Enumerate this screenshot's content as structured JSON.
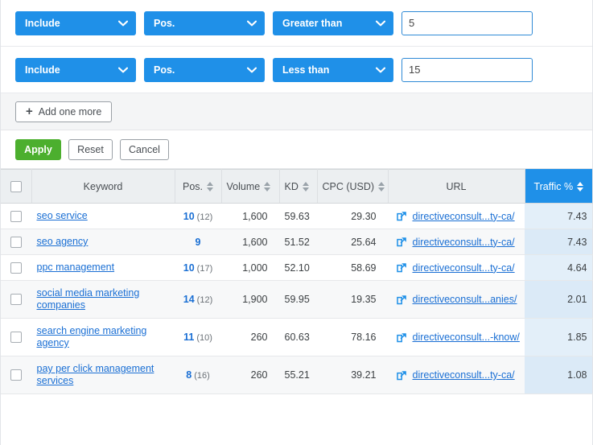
{
  "filters": {
    "rows": [
      {
        "mode": "Include",
        "metric": "Pos.",
        "comparator": "Greater than",
        "value": "5",
        "placeholder": ""
      },
      {
        "mode": "Include",
        "metric": "Pos.",
        "comparator": "Less than",
        "value": "15",
        "placeholder": ""
      }
    ],
    "add_more_label": "Add one more",
    "add_more_plus": "+",
    "apply_label": "Apply",
    "reset_label": "Reset",
    "cancel_label": "Cancel",
    "colors": {
      "dropdown_blue": "#1f90e8",
      "apply_green": "#4caf2e",
      "link_blue": "#1a6fd4",
      "traffic_header_blue": "#1f90e8",
      "traffic_cell_blue": "#e3eff9"
    }
  },
  "table": {
    "columns": [
      {
        "key": "check",
        "label": "",
        "sortable": false
      },
      {
        "key": "keyword",
        "label": "Keyword",
        "sortable": false
      },
      {
        "key": "pos",
        "label": "Pos.",
        "sortable": true
      },
      {
        "key": "volume",
        "label": "Volume",
        "sortable": true
      },
      {
        "key": "kd",
        "label": "KD",
        "sortable": true
      },
      {
        "key": "cpc",
        "label": "CPC (USD)",
        "sortable": true
      },
      {
        "key": "url",
        "label": "URL",
        "sortable": false
      },
      {
        "key": "traffic",
        "label": "Traffic %",
        "sortable": true
      }
    ],
    "rows": [
      {
        "keyword": "seo service",
        "pos": "10",
        "pos_prev": "(12)",
        "volume": "1,600",
        "kd": "59.63",
        "cpc": "29.30",
        "url": "directiveconsult...ty-ca/",
        "traffic": "7.43"
      },
      {
        "keyword": "seo agency",
        "pos": "9",
        "pos_prev": "",
        "volume": "1,600",
        "kd": "51.52",
        "cpc": "25.64",
        "url": "directiveconsult...ty-ca/",
        "traffic": "7.43"
      },
      {
        "keyword": "ppc management",
        "pos": "10",
        "pos_prev": "(17)",
        "volume": "1,000",
        "kd": "52.10",
        "cpc": "58.69",
        "url": "directiveconsult...ty-ca/",
        "traffic": "4.64"
      },
      {
        "keyword": "social media marketing companies",
        "pos": "14",
        "pos_prev": "(12)",
        "volume": "1,900",
        "kd": "59.95",
        "cpc": "19.35",
        "url": "directiveconsult...anies/",
        "traffic": "2.01"
      },
      {
        "keyword": "search engine marketing agency",
        "pos": "11",
        "pos_prev": "(10)",
        "volume": "260",
        "kd": "60.63",
        "cpc": "78.16",
        "url": "directiveconsult...-know/",
        "traffic": "1.85"
      },
      {
        "keyword": "pay per click management services",
        "pos": "8",
        "pos_prev": "(16)",
        "volume": "260",
        "kd": "55.21",
        "cpc": "39.21",
        "url": "directiveconsult...ty-ca/",
        "traffic": "1.08"
      }
    ]
  }
}
